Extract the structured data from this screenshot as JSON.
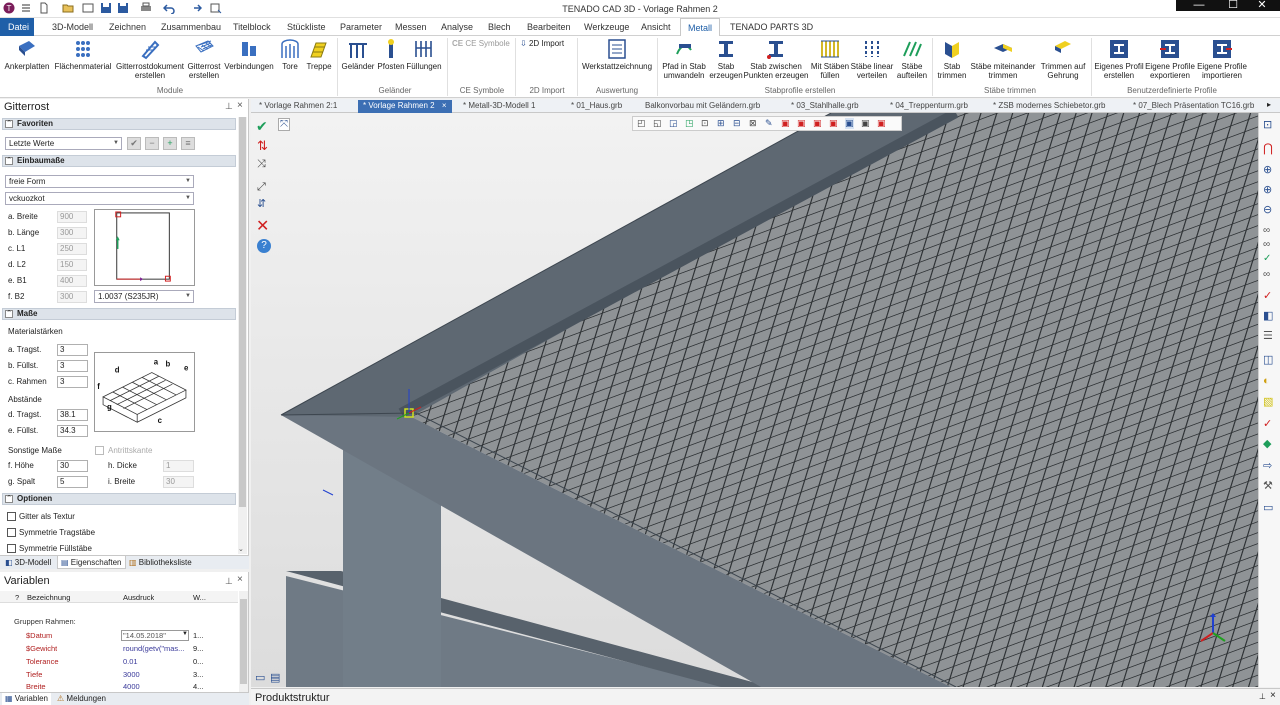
{
  "window": {
    "title": "TENADO CAD 3D - Vorlage Rahmen 2",
    "min": "—",
    "max": "☐",
    "close": "✕"
  },
  "tabs": [
    {
      "label": "Datei"
    },
    {
      "label": "3D-Modell"
    },
    {
      "label": "Zeichnen"
    },
    {
      "label": "Zusammenbau"
    },
    {
      "label": "Titelblock"
    },
    {
      "label": "Stückliste"
    },
    {
      "label": "Parameter"
    },
    {
      "label": "Messen"
    },
    {
      "label": "Analyse"
    },
    {
      "label": "Blech"
    },
    {
      "label": "Bearbeiten"
    },
    {
      "label": "Werkzeuge"
    },
    {
      "label": "Ansicht"
    },
    {
      "label": "Metall"
    },
    {
      "label": "TENADO PARTS 3D"
    }
  ],
  "ribbon": {
    "module": {
      "group": "Module",
      "items": [
        "Ankerplatten",
        "Flächenmaterial",
        "Gitterrostdokument erstellen",
        "Gitterrost erstellen",
        "Verbindungen",
        "Tore",
        "Treppe"
      ]
    },
    "gelaender": {
      "group": "Geländer",
      "items": [
        "Geländer",
        "Pfosten",
        "Füllungen"
      ]
    },
    "ce": {
      "group": "CE Symbole",
      "items": [
        "CE Symbole"
      ]
    },
    "import2d": {
      "group": "2D Import",
      "items": [
        "2D Import"
      ]
    },
    "auswertung": {
      "group": "Auswertung",
      "items": [
        "Werkstattzeichnung"
      ]
    },
    "stabprofile": {
      "group": "Stabprofile erstellen",
      "items": [
        "Pfad in Stab umwandeln",
        "Stab erzeugen",
        "Stab zwischen Punkten erzeugen",
        "Mit Stäben füllen",
        "Stäbe linear verteilen",
        "Stäbe aufteilen"
      ]
    },
    "trimmen": {
      "group": "Stäbe trimmen",
      "items": [
        "Stab trimmen",
        "Stäbe miteinander trimmen",
        "Trimmen auf Gehrung"
      ]
    },
    "benutzer": {
      "group": "Benutzerdefinierte Profile",
      "items": [
        "Eigenes Profil erstellen",
        "Eigene Profile exportieren",
        "Eigene Profile importieren"
      ]
    }
  },
  "gitterrost": {
    "title": "Gitterrost",
    "pin": "ᵖ",
    "close": "×",
    "favoriten": {
      "header": "Favoriten",
      "value": "Letzte Werte"
    },
    "einbaumasse": {
      "header": "Einbaumaße",
      "form": "freie Form",
      "kante": "vckuozkot",
      "rows": [
        {
          "label": "a.  Breite",
          "value": "900"
        },
        {
          "label": "b.  Länge",
          "value": "300"
        },
        {
          "label": "c.  L1",
          "value": "250"
        },
        {
          "label": "d.  L2",
          "value": "150"
        },
        {
          "label": "e.  B1",
          "value": "400"
        },
        {
          "label": "f.   B2",
          "value": "300"
        }
      ],
      "material": "1.0037 (S235JR)"
    },
    "masse": {
      "header": "Maße",
      "materialstaerken": "Materialstärken",
      "tragst_label": "a.  Tragst.",
      "tragst": "3",
      "fuellst_label": "b.  Füllst.",
      "fuellst": "3",
      "rahmen_label": "c.  Rahmen",
      "rahmen": "3",
      "abstaende": "Abstände",
      "d_label": "d.  Tragst.",
      "d_value": "38.1",
      "e_label": "e.  Füllst.",
      "e_value": "34.3",
      "sonstige": "Sonstige Maße",
      "antritt": "Antrittskante",
      "hoehe_label": "f.   Höhe",
      "hoehe": "30",
      "dicke_label": "h.  Dicke",
      "dicke": "1",
      "spalt_label": "g.  Spalt",
      "spalt": "5",
      "breite_label": "i.   Breite",
      "breite": "30"
    },
    "optionen": {
      "header": "Optionen",
      "items": [
        "Gitter als Textur",
        "Symmetrie Tragstäbe",
        "Symmetrie Füllstäbe"
      ]
    },
    "bottom_tabs": [
      "3D-Modell",
      "Eigenschaften",
      "Bibliotheksliste"
    ]
  },
  "variablen": {
    "title": "Variablen",
    "columns": [
      "?",
      "Bezeichnung",
      "Ausdruck",
      "W..."
    ],
    "group": "Gruppen Rahmen:",
    "rows": [
      {
        "name": "$Datum",
        "expr": "\"14.05.2018\"",
        "w": "1..."
      },
      {
        "name": "$Gewicht",
        "expr": "round(getv(\"mas...",
        "w": "9..."
      },
      {
        "name": "Tolerance",
        "expr": "0.01",
        "w": "0..."
      },
      {
        "name": "Tiefe",
        "expr": "3000",
        "w": "3..."
      },
      {
        "name": "Breite",
        "expr": "4000",
        "w": "4..."
      }
    ],
    "bottom_tabs": [
      "Variablen",
      "Meldungen"
    ]
  },
  "doc_tabs": [
    "* Vorlage Rahmen 2:1",
    "* Vorlage Rahmen 2",
    "* Metall-3D-Modell 1",
    "* 01_Haus.grb",
    "Balkonvorbau mit Geländern.grb",
    "* 03_Stahlhalle.grb",
    "* 04_Treppenturm.grb",
    "* ZSB modernes Schiebetor.grb",
    "* 07_Blech Präsentation TC16.grb"
  ],
  "status": {
    "produktstruktur": "Produktstruktur"
  },
  "colors": {
    "accent": "#1f5fa8",
    "active_tab": "#3c6fb4",
    "steel": "#5d6670"
  }
}
